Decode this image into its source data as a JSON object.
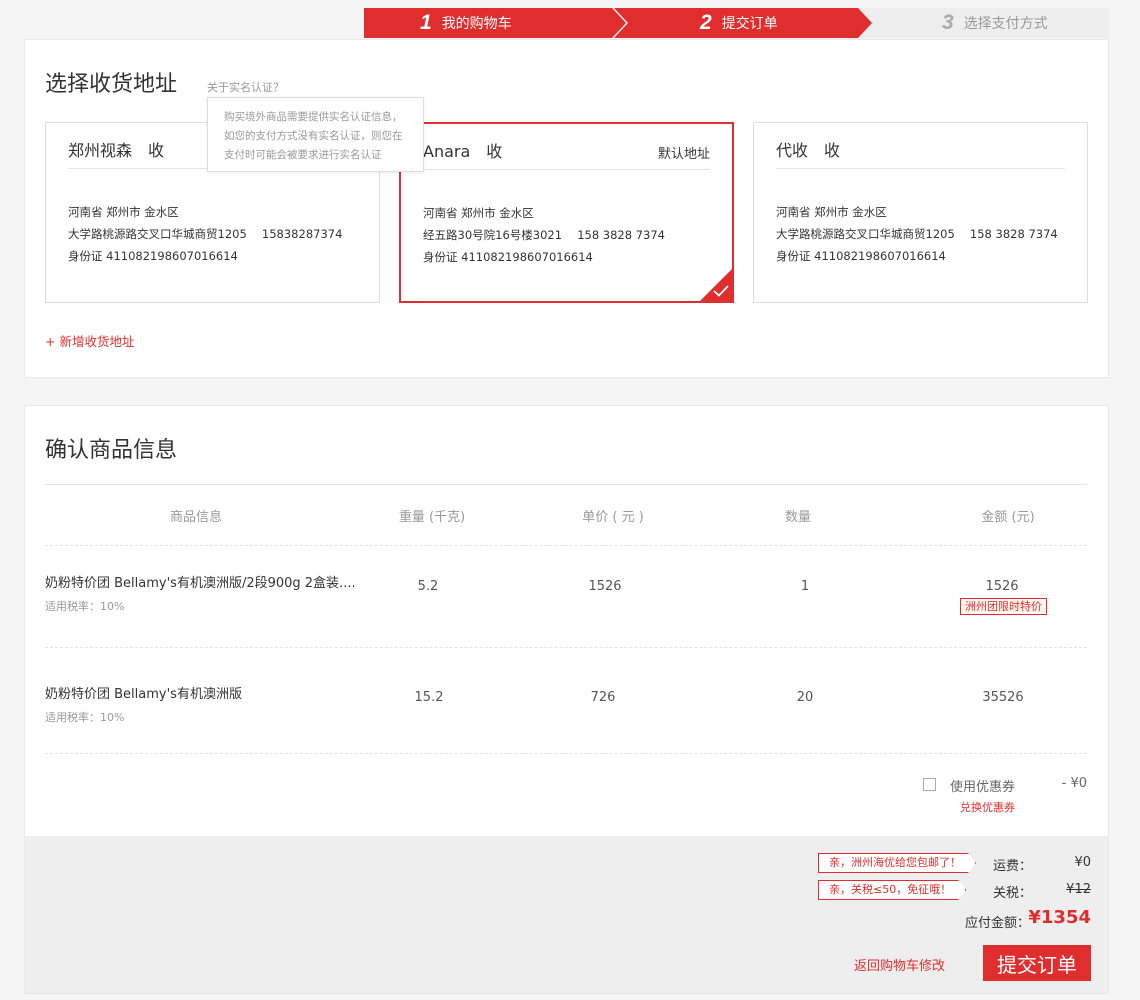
{
  "steps": [
    {
      "num": "1",
      "label": "我的购物车"
    },
    {
      "num": "2",
      "label": "提交订单"
    },
    {
      "num": "3",
      "label": "选择支付方式"
    }
  ],
  "address": {
    "title": "选择收货地址",
    "realname_link": "关于实名认证？",
    "tooltip_lines": [
      "购买境外商品需要提供实名认证信息，",
      "如您的支付方式没有实名认证，则您在",
      "支付时可能会被要求进行实名认证"
    ],
    "cards": [
      {
        "name": "郑州视森　收",
        "default": "",
        "lines": [
          "河南省 郑州市 金水区",
          "大学路桃源路交叉口华城商贸1205　 15838287374",
          "身份证 411082198607016614"
        ]
      },
      {
        "name": "Anara　收",
        "default": "默认地址",
        "lines": [
          "河南省 郑州市 金水区",
          "经五路30号院16号楼3021　 158 3828 7374",
          "身份证 411082198607016614"
        ]
      },
      {
        "name": "代收　收",
        "default": "",
        "lines": [
          "河南省 郑州市 金水区",
          "大学路桃源路交叉口华城商贸1205　 158 3828 7374",
          "身份证 411082198607016614"
        ]
      }
    ],
    "add_label": "+ 新增收货地址"
  },
  "goods": {
    "title": "确认商品信息",
    "headers": [
      "商品信息",
      "重量 (千克)",
      "单价 ( 元 )",
      "数量",
      "金额 (元)"
    ],
    "rows": [
      {
        "name": "奶粉特价团  Bellamy's有机澳洲版/2段900g 2盒装....",
        "tax": "适用税率：10%",
        "weight": "5.2",
        "price": "1526",
        "qty": "1",
        "amount": "1526",
        "badge": "洲州团限时特价"
      },
      {
        "name": "奶粉特价团  Bellamy's有机澳洲版",
        "tax": "适用税率：10%",
        "weight": "15.2",
        "price": "726",
        "qty": "20",
        "amount": "35526",
        "badge": ""
      }
    ],
    "coupon_label": "使用优惠券",
    "coupon_value": "- ¥0",
    "coupon_exchange": "兑换优惠券"
  },
  "summary": {
    "shipping_tag": "亲，洲州海优给您包邮了！",
    "shipping_label": "运费：",
    "shipping_value": "¥0",
    "tax_tag": "亲，关税≤50，免征哦！",
    "tax_label": "关税：",
    "tax_value": "¥12",
    "total_label": "应付金额：",
    "total_value": "¥1354",
    "back_label": "返回购物车修改",
    "submit_label": "提交订单"
  },
  "colors": {
    "accent": "#e02e2e"
  }
}
